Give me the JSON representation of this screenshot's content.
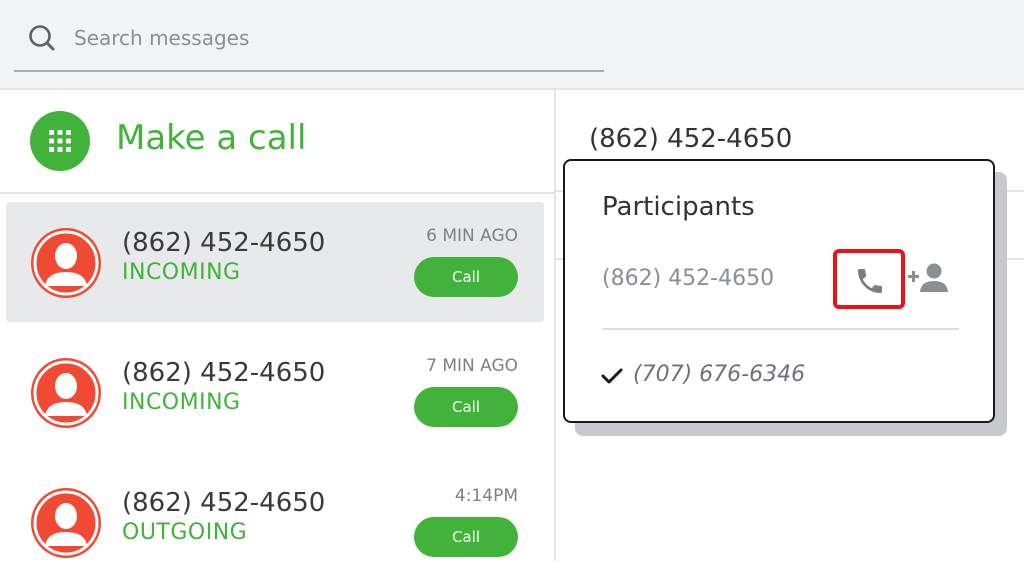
{
  "search": {
    "placeholder": "Search messages",
    "icon": "search-icon"
  },
  "make_call": {
    "label": "Make a call",
    "icon": "dialpad-icon",
    "color": "#41b33a"
  },
  "calls": [
    {
      "number": "(862) 452-4650",
      "direction": "INCOMING",
      "time": "6 MIN AGO",
      "button": "Call",
      "selected": true
    },
    {
      "number": "(862) 452-4650",
      "direction": "INCOMING",
      "time": "7 MIN AGO",
      "button": "Call",
      "selected": false
    },
    {
      "number": "(862) 452-4650",
      "direction": "OUTGOING",
      "time": "4:14PM",
      "button": "Call",
      "selected": false
    }
  ],
  "conversation": {
    "number": "(862) 452-4650"
  },
  "participants": {
    "title": "Participants",
    "other": "(862) 452-4650",
    "self": "(707) 676-6346",
    "call_icon": "phone-icon",
    "add_icon": "add-person-icon",
    "highlight_color": "#e8141a"
  },
  "colors": {
    "accent": "#41b33a",
    "avatar": "#f04a34",
    "selected_bg": "#e7e9eb"
  }
}
